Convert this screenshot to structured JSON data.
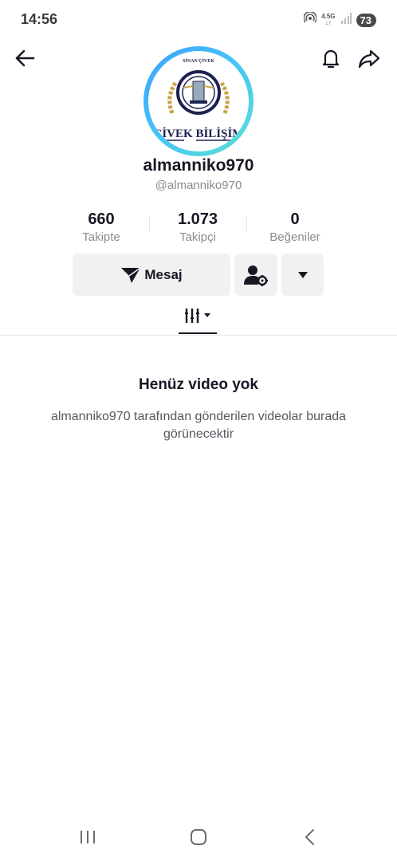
{
  "status_bar": {
    "time": "14:56",
    "network_type": "4.5G",
    "battery_level": "73",
    "icons": [
      "hotspot-icon",
      "data-arrows-icon",
      "signal-icon",
      "battery-icon"
    ]
  },
  "nav": {
    "back_icon": "arrow-left-icon",
    "notification_icon": "bell-icon",
    "share_icon": "share-arrow-icon"
  },
  "profile": {
    "avatar_text_top": "SİNAN ÇİVEK",
    "avatar_text_main": "ÇİVEK BİLİŞİM",
    "display_name": "almanniko970",
    "handle": "@almanniko970"
  },
  "stats": [
    {
      "value": "660",
      "label": "Takipte"
    },
    {
      "value": "1.073",
      "label": "Takipçi"
    },
    {
      "value": "0",
      "label": "Beğeniler"
    }
  ],
  "actions": {
    "message_label": "Mesaj",
    "message_icon": "send-plane-icon",
    "follow_settings_icon": "user-settings-icon",
    "more_icon": "caret-down-icon"
  },
  "tabs": {
    "videos_icon": "grid-filter-icon"
  },
  "empty_state": {
    "title": "Henüz video yok",
    "description": "almanniko970 tarafından gönderilen videolar burada görünecektir"
  },
  "system_nav": {
    "recent_icon": "recent-apps-icon",
    "home_icon": "home-icon",
    "back_icon": "back-icon"
  },
  "colors": {
    "text_primary": "#161823",
    "text_secondary": "#8a8b91",
    "button_bg": "#f1f1f2",
    "avatar_ring_start": "#3aa0ff",
    "avatar_ring_end": "#5fe0d0"
  }
}
